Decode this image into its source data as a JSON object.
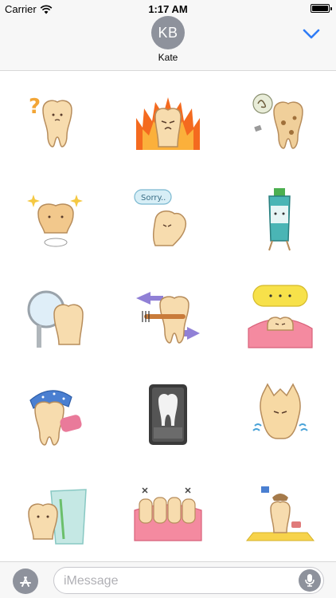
{
  "status_bar": {
    "carrier": "Carrier",
    "time": "1:17 AM"
  },
  "header": {
    "avatar_initials": "KB",
    "contact_name": "Kate",
    "expand_icon": "chevron-down-icon",
    "accent_color": "#2f7cf6",
    "avatar_color": "#8e929c"
  },
  "stickers": [
    {
      "name": "tooth-question"
    },
    {
      "name": "tooth-on-fire"
    },
    {
      "name": "tooth-decayed"
    },
    {
      "name": "tooth-sparkle"
    },
    {
      "name": "tooth-sorry",
      "text": "Sorry.."
    },
    {
      "name": "toothpaste"
    },
    {
      "name": "tooth-dental-mirror"
    },
    {
      "name": "tooth-flossing"
    },
    {
      "name": "tooth-gum-speech"
    },
    {
      "name": "tooth-sleepy"
    },
    {
      "name": "tooth-xray"
    },
    {
      "name": "tooth-crying"
    },
    {
      "name": "tooth-glass"
    },
    {
      "name": "teeth-row"
    },
    {
      "name": "tooth-beach"
    }
  ],
  "bottom_bar": {
    "appstore_icon": "app-store-icon",
    "message_placeholder": "iMessage",
    "mic_icon": "microphone-icon"
  }
}
